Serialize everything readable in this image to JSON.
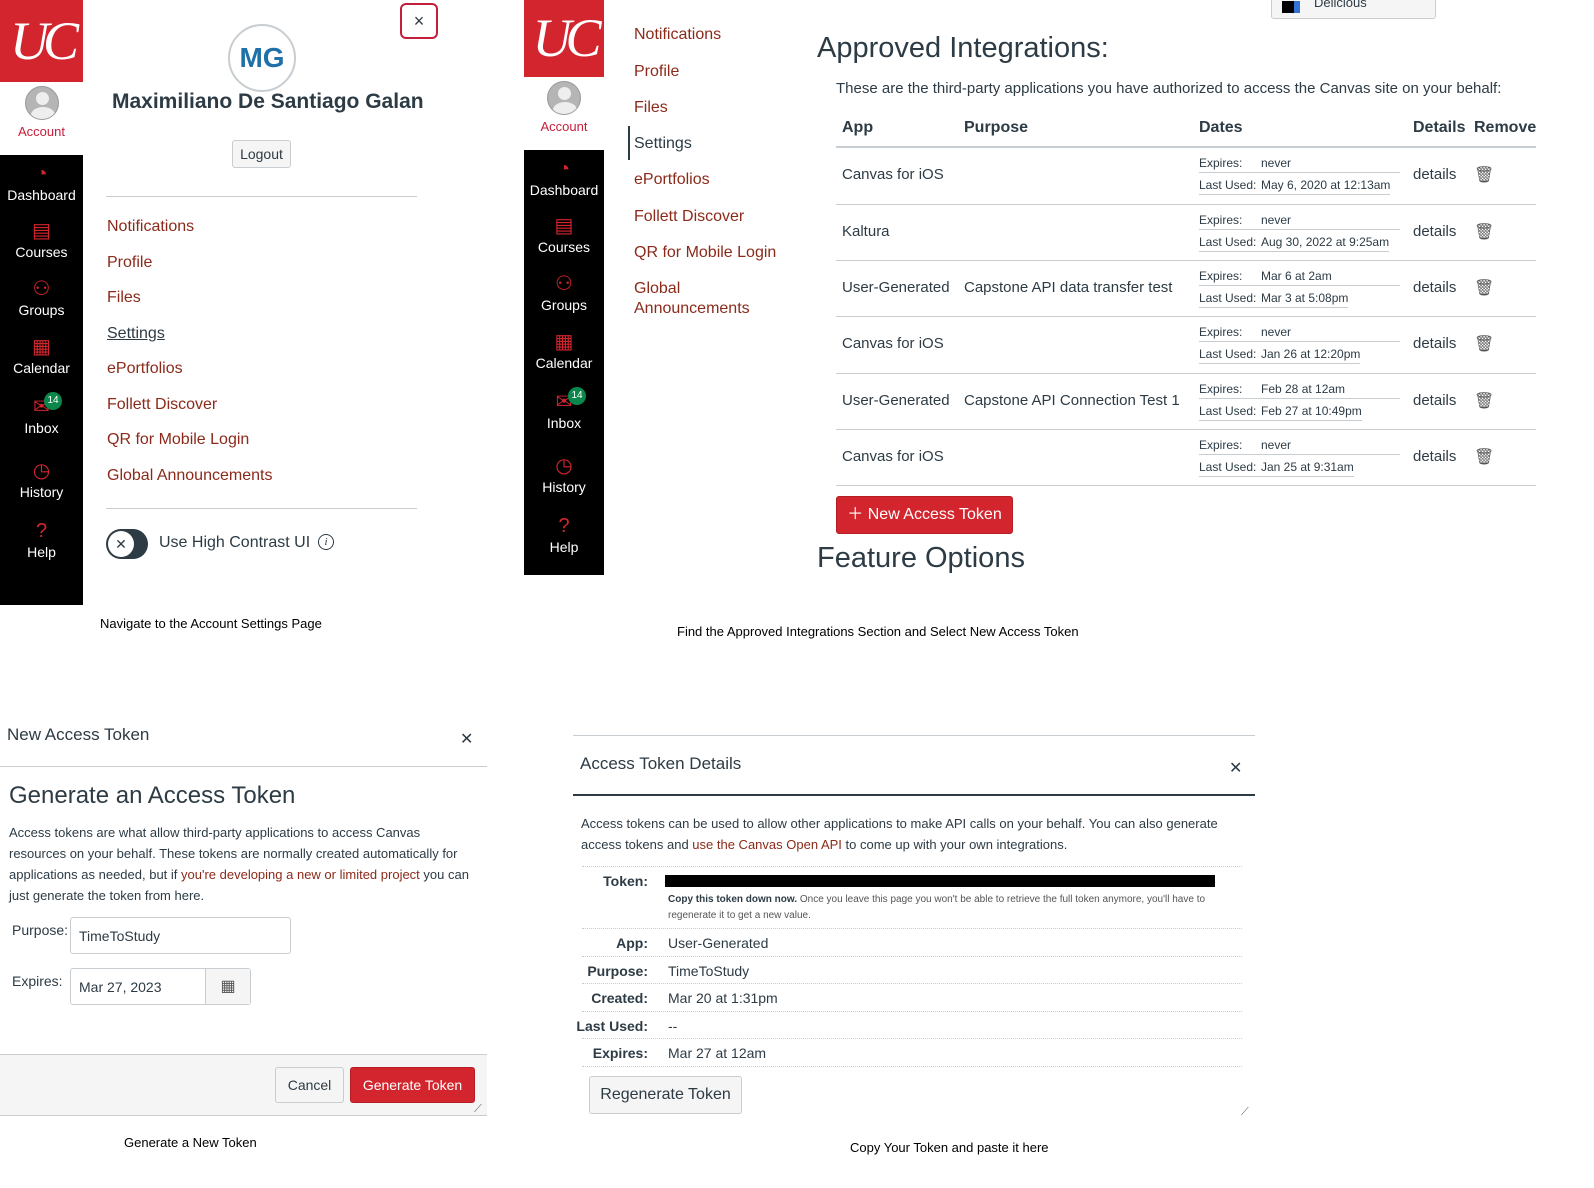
{
  "panel1": {
    "initials": "MG",
    "user_name": "Maximiliano De Santiago Galan",
    "logout": "Logout",
    "close": "×",
    "menu": [
      "Notifications",
      "Profile",
      "Files",
      "Settings",
      "ePortfolios",
      "Follett Discover",
      "QR for Mobile Login",
      "Global Announcements"
    ],
    "high_contrast": "Use High Contrast UI",
    "caption": "Navigate to the Account Settings Page"
  },
  "global_nav": {
    "logo": "UC",
    "account": "Account",
    "items": [
      {
        "label": "Dashboard",
        "icon": "dashboard-icon",
        "glyph": "◔"
      },
      {
        "label": "Courses",
        "icon": "courses-icon",
        "glyph": "▤"
      },
      {
        "label": "Groups",
        "icon": "groups-icon",
        "glyph": "⚇"
      },
      {
        "label": "Calendar",
        "icon": "calendar-icon",
        "glyph": "▦"
      },
      {
        "label": "Inbox",
        "icon": "inbox-icon",
        "glyph": "✉"
      },
      {
        "label": "History",
        "icon": "history-icon",
        "glyph": "◷"
      },
      {
        "label": "Help",
        "icon": "help-icon",
        "glyph": "?"
      }
    ],
    "inbox_badge": "14"
  },
  "panel2": {
    "subnav": [
      "Notifications",
      "Profile",
      "Files",
      "Settings",
      "ePortfolios",
      "Follett Discover",
      "QR for Mobile Login",
      "Global Announcements"
    ],
    "dropdown_text": "Delicious",
    "title": "Approved Integrations:",
    "intro": "These are the third-party applications you have authorized to access the Canvas site on your behalf:",
    "headers": {
      "app": "App",
      "purpose": "Purpose",
      "dates": "Dates",
      "details": "Details",
      "remove": "Remove"
    },
    "expires_label": "Expires:",
    "last_used_label": "Last Used:",
    "details_link": "details",
    "rows": [
      {
        "app": "Canvas for iOS",
        "purpose": "",
        "expires": "never",
        "last_used": "May 6, 2020 at 12:13am"
      },
      {
        "app": "Kaltura",
        "purpose": "",
        "expires": "never",
        "last_used": "Aug 30, 2022 at 9:25am"
      },
      {
        "app": "User-Generated",
        "purpose": "Capstone API data transfer test",
        "expires": "Mar 6 at 2am",
        "last_used": "Mar 3 at 5:08pm"
      },
      {
        "app": "Canvas for iOS",
        "purpose": "",
        "expires": "never",
        "last_used": "Jan 26 at 12:20pm"
      },
      {
        "app": "User-Generated",
        "purpose": "Capstone API Connection Test 1",
        "expires": "Feb 28 at 12am",
        "last_used": "Feb 27 at 10:49pm"
      },
      {
        "app": "Canvas for iOS",
        "purpose": "",
        "expires": "never",
        "last_used": "Jan 25 at 9:31am"
      }
    ],
    "new_token": "New Access Token",
    "feature_options": "Feature Options",
    "caption": "Find the Approved Integrations Section and Select New Access Token"
  },
  "panel3": {
    "dialog_title": "New Access Token",
    "heading": "Generate an Access Token",
    "desc_part1": "Access tokens are what allow third-party applications to access Canvas resources on your behalf. These tokens are normally created automatically for applications as needed, but if ",
    "desc_link": "you're developing a new or limited project",
    "desc_part2": " you can just generate the token from here.",
    "purpose_label": "Purpose:",
    "purpose_value": "TimeToStudy",
    "expires_label": "Expires:",
    "expires_value": "Mar 27, 2023",
    "cancel": "Cancel",
    "generate": "Generate Token",
    "caption": "Generate a New Token"
  },
  "panel4": {
    "dialog_title": "Access Token Details",
    "desc_part1": "Access tokens can be used to allow other applications to make API calls on your behalf. You can also generate access tokens and ",
    "desc_link": "use the Canvas Open API",
    "desc_part2": " to come up with your own integrations.",
    "token_label": "Token:",
    "token_note_bold": "Copy this token down now.",
    "token_note": " Once you leave this page you won't be able to retrieve the full token anymore, you'll have to regenerate it to get a new value.",
    "details": [
      {
        "k": "App:",
        "v": "User-Generated"
      },
      {
        "k": "Purpose:",
        "v": "TimeToStudy"
      },
      {
        "k": "Created:",
        "v": "Mar 20 at 1:31pm"
      },
      {
        "k": "Last Used:",
        "v": "--"
      },
      {
        "k": "Expires:",
        "v": "Mar 27 at 12am"
      }
    ],
    "regenerate": "Regenerate Token",
    "caption": "Copy Your Token and paste it here"
  }
}
